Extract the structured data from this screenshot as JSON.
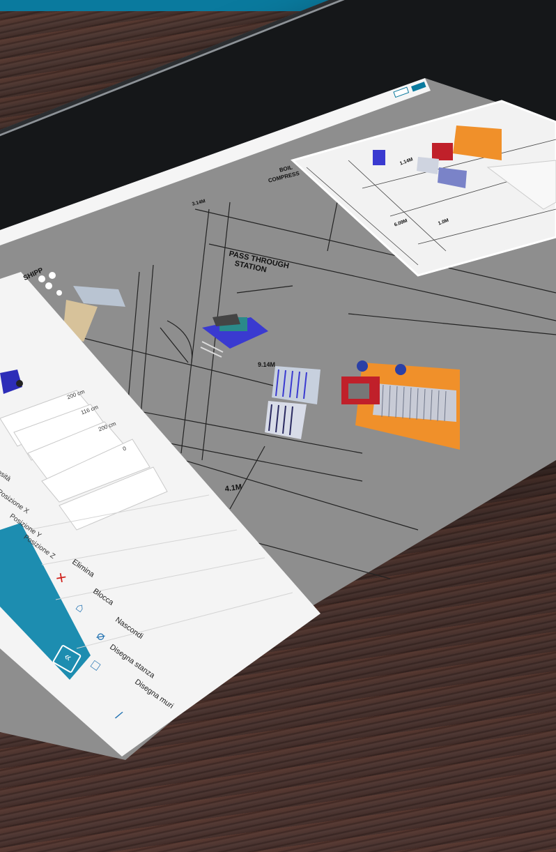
{
  "colors": {
    "brand": "#0a7a9e",
    "plan_background": "#8c8c8c",
    "panel_background": "#f4f4f4",
    "conveyor_orange": "#f0902a",
    "robot_blue": "#3a3ad0",
    "delete_red": "#d0201a"
  },
  "properties_panel": {
    "fields": [
      {
        "label": "osità",
        "value": "200 cm"
      },
      {
        "label": "Posizione X",
        "value": "116 cm"
      },
      {
        "label": "Posizione Y",
        "value": "200 cm"
      },
      {
        "label": "Posizione Z",
        "value": "0"
      }
    ]
  },
  "actions_menu": [
    {
      "label": "Elimina",
      "icon": "close-icon"
    },
    {
      "label": "Blocca",
      "icon": "lock-icon"
    },
    {
      "label": "Nascondi",
      "icon": "eye-off-icon"
    },
    {
      "label": "Disegna stanza",
      "icon": "square-icon"
    },
    {
      "label": "Disegna muri",
      "icon": "line-icon"
    }
  ],
  "collapse_button": {
    "glyph": "«"
  },
  "floor_plan": {
    "labels": [
      "PASS THROUGH",
      "STATION",
      "4.1M",
      "9.14M",
      "BOIL",
      "COMPRESS",
      "3.14M",
      "SHIPP"
    ]
  },
  "minimap": {
    "labels": [
      "6.09M",
      "1.0M",
      "1.14M"
    ]
  }
}
